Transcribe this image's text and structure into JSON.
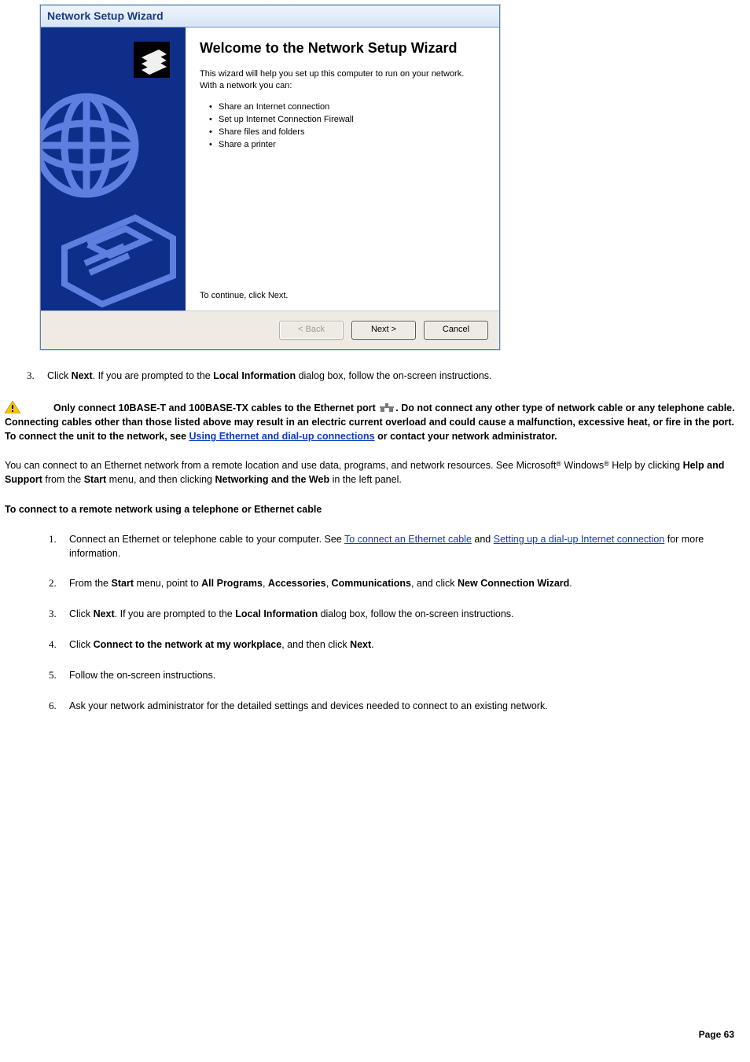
{
  "wizard": {
    "title": "Network Setup Wizard",
    "heading": "Welcome to the Network Setup Wizard",
    "intro": "This wizard will help you set up this computer to run on your network. With a network you can:",
    "bullets": [
      "Share an Internet connection",
      "Set up Internet Connection Firewall",
      "Share files and folders",
      "Share a printer"
    ],
    "continue": "To continue, click Next.",
    "buttons": {
      "back": "< Back",
      "next": "Next >",
      "cancel": "Cancel"
    }
  },
  "step3": {
    "num": "3.",
    "t1": "Click ",
    "b1": "Next",
    "t2": ". If you are prompted to the ",
    "b2": "Local Information",
    "t3": " dialog box, follow the on-screen instructions."
  },
  "warn": {
    "t1": "Only connect 10BASE-T and 100BASE-TX cables to the Ethernet port ",
    "t2": ". Do not connect any other type of network cable or any telephone cable. Connecting cables other than those listed above may result in an electric current overload and could cause a malfunction, excessive heat, or fire in the port. To connect the unit to the network, see ",
    "link": "Using Ethernet and dial-up connections",
    "t3": " or contact your network administrator."
  },
  "para1": {
    "t1": "You can connect to an Ethernet network from a remote location and use data, programs, and network resources. See Microsoft",
    "reg": "®",
    "t2": " Windows",
    "t3": " Help by clicking ",
    "b1": "Help and Support",
    "t4": " from the ",
    "b2": "Start",
    "t5": " menu, and then clicking ",
    "b3": "Networking and the Web",
    "t6": " in the left panel."
  },
  "heading2": "To connect to a remote network using a telephone or Ethernet cable",
  "list2": {
    "i1": {
      "num": "1.",
      "t1": "Connect an Ethernet or telephone cable to your computer. See ",
      "l1": "To connect an Ethernet cable",
      "t2": " and ",
      "l2": "Setting up a dial-up Internet connection",
      "t3": " for more information."
    },
    "i2": {
      "num": "2.",
      "t1": "From the ",
      "b1": "Start",
      "t2": " menu, point to ",
      "b2": "All Programs",
      "t3": ", ",
      "b3": "Accessories",
      "t4": ", ",
      "b4": "Communications",
      "t5": ", and click ",
      "b5": "New Connection Wizard",
      "t6": "."
    },
    "i3": {
      "num": "3.",
      "t1": "Click ",
      "b1": "Next",
      "t2": ". If you are prompted to the ",
      "b2": "Local Information",
      "t3": " dialog box, follow the on-screen instructions."
    },
    "i4": {
      "num": "4.",
      "t1": "Click ",
      "b1": "Connect to the network at my workplace",
      "t2": ", and then click ",
      "b2": "Next",
      "t3": "."
    },
    "i5": {
      "num": "5.",
      "t1": "Follow the on-screen instructions."
    },
    "i6": {
      "num": "6.",
      "t1": "Ask your network administrator for the detailed settings and devices needed to connect to an existing network."
    }
  },
  "footer": "Page 63"
}
